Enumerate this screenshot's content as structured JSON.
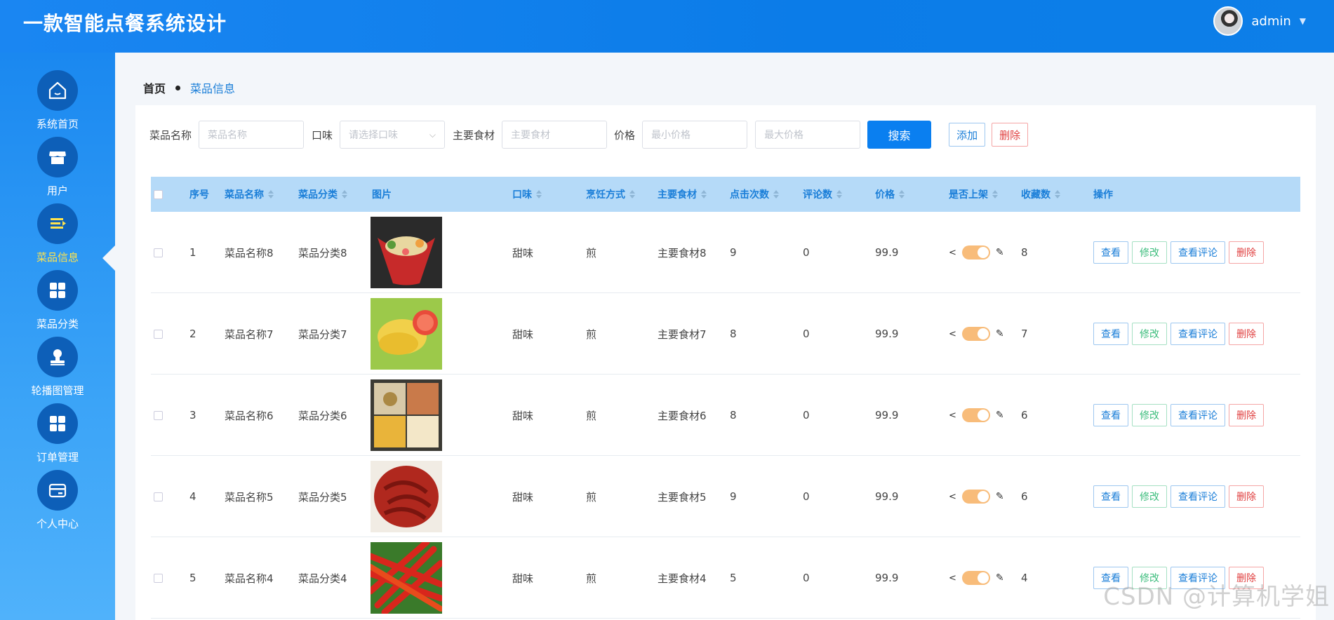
{
  "header": {
    "title": "一款智能点餐系统设计",
    "username": "admin"
  },
  "sidebar": {
    "items": [
      {
        "label": "系统首页",
        "icon": "home-icon"
      },
      {
        "label": "用户",
        "icon": "shop-icon"
      },
      {
        "label": "菜品信息",
        "icon": "list-icon",
        "active": true
      },
      {
        "label": "菜品分类",
        "icon": "grid-icon"
      },
      {
        "label": "轮播图管理",
        "icon": "stamp-icon"
      },
      {
        "label": "订单管理",
        "icon": "grid-icon"
      },
      {
        "label": "个人中心",
        "icon": "card-icon"
      }
    ]
  },
  "breadcrumb": {
    "home": "首页",
    "current": "菜品信息"
  },
  "search": {
    "name_label": "菜品名称",
    "name_placeholder": "菜品名称",
    "taste_label": "口味",
    "taste_placeholder": "请选择口味",
    "ingredient_label": "主要食材",
    "ingredient_placeholder": "主要食材",
    "price_label": "价格",
    "min_placeholder": "最小价格",
    "max_placeholder": "最大价格",
    "search_button": "搜索",
    "add_button": "添加",
    "delete_button": "删除"
  },
  "table": {
    "columns": {
      "index": "序号",
      "name": "菜品名称",
      "category": "菜品分类",
      "image": "图片",
      "taste": "口味",
      "cooking": "烹饪方式",
      "ingredient": "主要食材",
      "clicks": "点击次数",
      "comments": "评论数",
      "price": "价格",
      "on_sale": "是否上架",
      "favorites": "收藏数",
      "actions": "操作"
    },
    "rows": [
      {
        "index": "1",
        "name": "菜品名称8",
        "category": "菜品分类8",
        "taste": "甜味",
        "cooking": "煎",
        "ingredient": "主要食材8",
        "clicks": "9",
        "comments": "0",
        "price": "99.9",
        "favorites": "8",
        "on_sale": true
      },
      {
        "index": "2",
        "name": "菜品名称7",
        "category": "菜品分类7",
        "taste": "甜味",
        "cooking": "煎",
        "ingredient": "主要食材7",
        "clicks": "8",
        "comments": "0",
        "price": "99.9",
        "favorites": "7",
        "on_sale": true
      },
      {
        "index": "3",
        "name": "菜品名称6",
        "category": "菜品分类6",
        "taste": "甜味",
        "cooking": "煎",
        "ingredient": "主要食材6",
        "clicks": "8",
        "comments": "0",
        "price": "99.9",
        "favorites": "6",
        "on_sale": true
      },
      {
        "index": "4",
        "name": "菜品名称5",
        "category": "菜品分类5",
        "taste": "甜味",
        "cooking": "煎",
        "ingredient": "主要食材5",
        "clicks": "9",
        "comments": "0",
        "price": "99.9",
        "favorites": "6",
        "on_sale": true
      },
      {
        "index": "5",
        "name": "菜品名称4",
        "category": "菜品分类4",
        "taste": "甜味",
        "cooking": "煎",
        "ingredient": "主要食材4",
        "clicks": "5",
        "comments": "0",
        "price": "99.9",
        "favorites": "4",
        "on_sale": true
      }
    ],
    "actions": {
      "view": "查看",
      "edit": "修改",
      "comments": "查看评论",
      "delete": "删除"
    }
  },
  "watermark": "CSDN @计算机学姐",
  "colors": {
    "primary": "#0a7ff0",
    "header_bg": "#1a86f2",
    "active_nav": "#ffe34d",
    "toggle_on": "#f8bc7a"
  }
}
